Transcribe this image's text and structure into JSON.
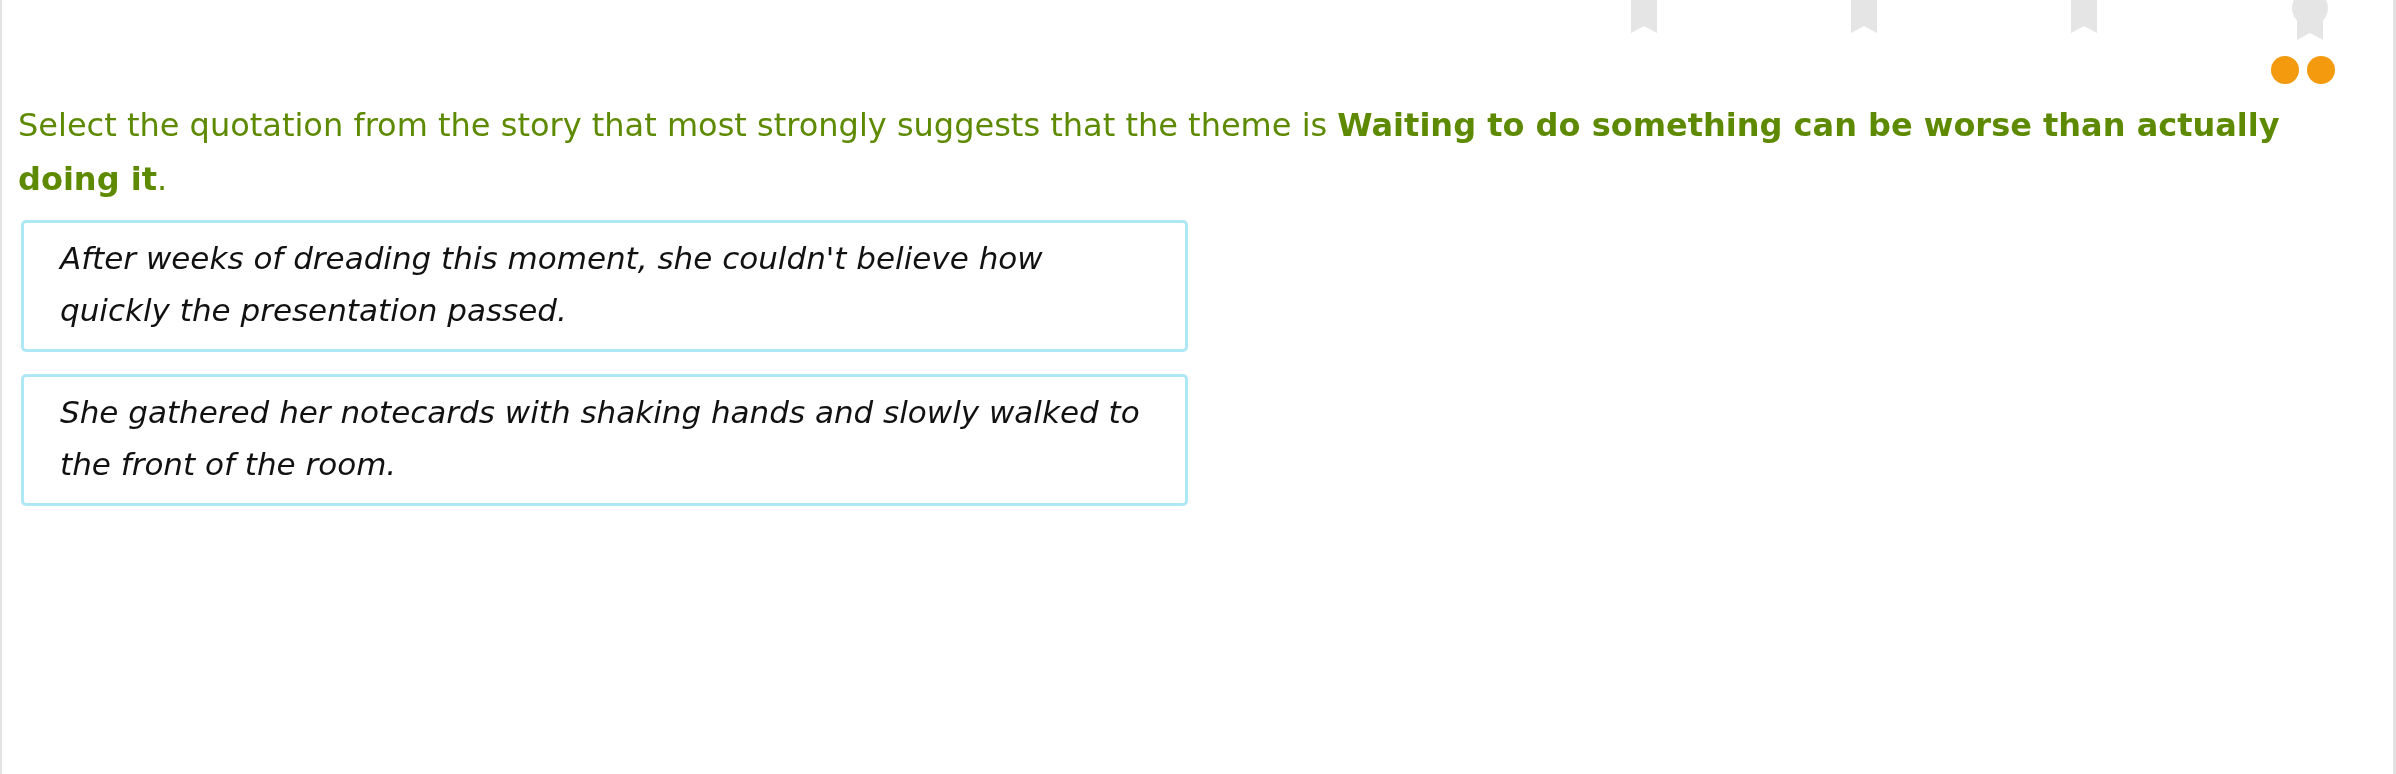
{
  "question": {
    "prompt": "Select the quotation from the story that most strongly suggests that the theme is **Waiting to do something can be worse than actually doing it**."
  },
  "choices": [
    {
      "text": "After weeks of dreading this moment, she couldn't believe how quickly the presentation passed."
    },
    {
      "text": "She gathered her notecards with shaking hands and slowly walked to the front of the room."
    }
  ]
}
